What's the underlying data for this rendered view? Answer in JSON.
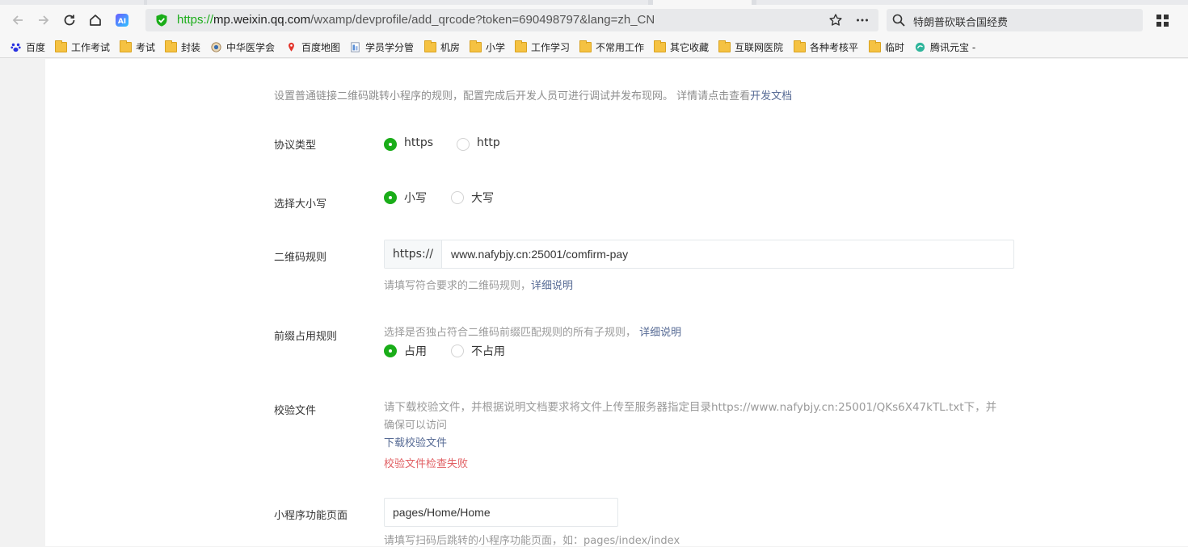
{
  "browser": {
    "url_scheme": "https://",
    "url_host": "mp.weixin.qq.com",
    "url_path": "/wxamp/devprofile/add_qrcode?token=690498797&lang=zh_CN",
    "search_text": "特朗普砍联合国经费",
    "bookmarks": [
      "百度",
      "工作考试",
      "考试",
      "封装",
      "中华医学会",
      "百度地图",
      "学员学分管",
      "机房",
      "小学",
      "工作学习",
      "不常用工作",
      "其它收藏",
      "互联网医院",
      "各种考核平",
      "临时",
      "腾讯元宝 -"
    ]
  },
  "intro": {
    "text": "设置普通链接二维码跳转小程序的规则，配置完成后开发人员可进行调试并发布现网。 详情请点击查看",
    "link": "开发文档"
  },
  "protocol": {
    "label": "协议类型",
    "options": [
      "https",
      "http"
    ],
    "selected": "https"
  },
  "case": {
    "label": "选择大小写",
    "options": [
      "小写",
      "大写"
    ],
    "selected": "小写"
  },
  "qrrule": {
    "label": "二维码规则",
    "prefix": "https://",
    "value": "www.nafybjy.cn:25001/comfirm-pay",
    "hint": "请填写符合要求的二维码规则，",
    "hint_link": "详细说明"
  },
  "prefix_rule": {
    "label": "前缀占用规则",
    "desc": "选择是否独占符合二维码前缀匹配规则的所有子规则，",
    "desc_link": "详细说明",
    "options": [
      "占用",
      "不占用"
    ],
    "selected": "占用"
  },
  "verify": {
    "label": "校验文件",
    "line1": "请下载校验文件，并根据说明文档要求将文件上传至服务器指定目录https://www.nafybjy.cn:25001/QKs6X47kTL.txt下，并",
    "line2": "确保可以访问",
    "download": "下载校验文件",
    "error": "校验文件检查失败"
  },
  "page_path": {
    "label": "小程序功能页面",
    "value": "pages/Home/Home",
    "hint": "请填写扫码后跳转的小程序功能页面，如：pages/index/index"
  },
  "colors": {
    "accent": "#1aad19",
    "link": "#576b95",
    "error": "#e15f63"
  }
}
